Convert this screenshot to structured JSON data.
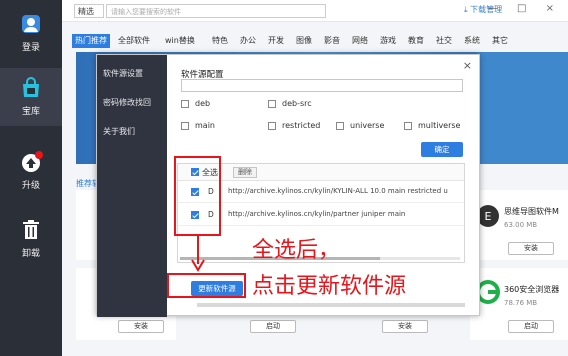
{
  "rail": {
    "items": [
      {
        "label": "登录",
        "icon": "user-icon"
      },
      {
        "label": "宝库",
        "icon": "store-icon"
      },
      {
        "label": "升级",
        "icon": "upgrade-icon",
        "badge": "1"
      },
      {
        "label": "卸载",
        "icon": "trash-icon"
      }
    ]
  },
  "topbar": {
    "select_value": "精选",
    "search_placeholder": "请输入您要搜索的软件",
    "download_label": "下载管理",
    "window_controls": "— □ ×"
  },
  "tabs": [
    "热门推荐",
    "全部软件",
    "win替换",
    "特色",
    "办公",
    "开发",
    "图像",
    "影音",
    "网络",
    "游戏",
    "教育",
    "社交",
    "系统",
    "其它"
  ],
  "recommend_label": "推荐软件",
  "cards": {
    "right_top": {
      "title": "思维导图软件M",
      "size": "63.00 MB",
      "button": "安装"
    },
    "right_bottom": {
      "title": "360安全浏览器",
      "size": "78.76 MB",
      "button": "启动"
    },
    "bottom_buttons": [
      "安装",
      "启动",
      "安装"
    ]
  },
  "modal": {
    "side_items": [
      "软件源设置",
      "密码修改找回",
      "关于我们"
    ],
    "close": "×",
    "section_title": "软件源配置",
    "url_value": "",
    "options": [
      {
        "label": "deb",
        "checked": false
      },
      {
        "label": "deb-src",
        "checked": false
      },
      {
        "label": "main",
        "checked": false
      },
      {
        "label": "restricted",
        "checked": false
      },
      {
        "label": "universe",
        "checked": false
      },
      {
        "label": "multiverse",
        "checked": false
      }
    ],
    "confirm_label": "确定",
    "list": {
      "select_all_label": "全选",
      "delete_label": "删除",
      "rows": [
        {
          "type": "D",
          "url": "http://archive.kylinos.cn/kylin/KYLIN-ALL 10.0 main restricted u",
          "checked": true
        },
        {
          "type": "D",
          "url": "http://archive.kylinos.cn/kylin/partner juniper main",
          "checked": true
        }
      ]
    },
    "update_label": "更新软件源"
  },
  "annotations": {
    "line1": "全选后，",
    "line2": "点击更新软件源"
  },
  "colors": {
    "accent": "#2d7ee0",
    "annotation": "#e8151b",
    "rail": "#2b2f38"
  }
}
